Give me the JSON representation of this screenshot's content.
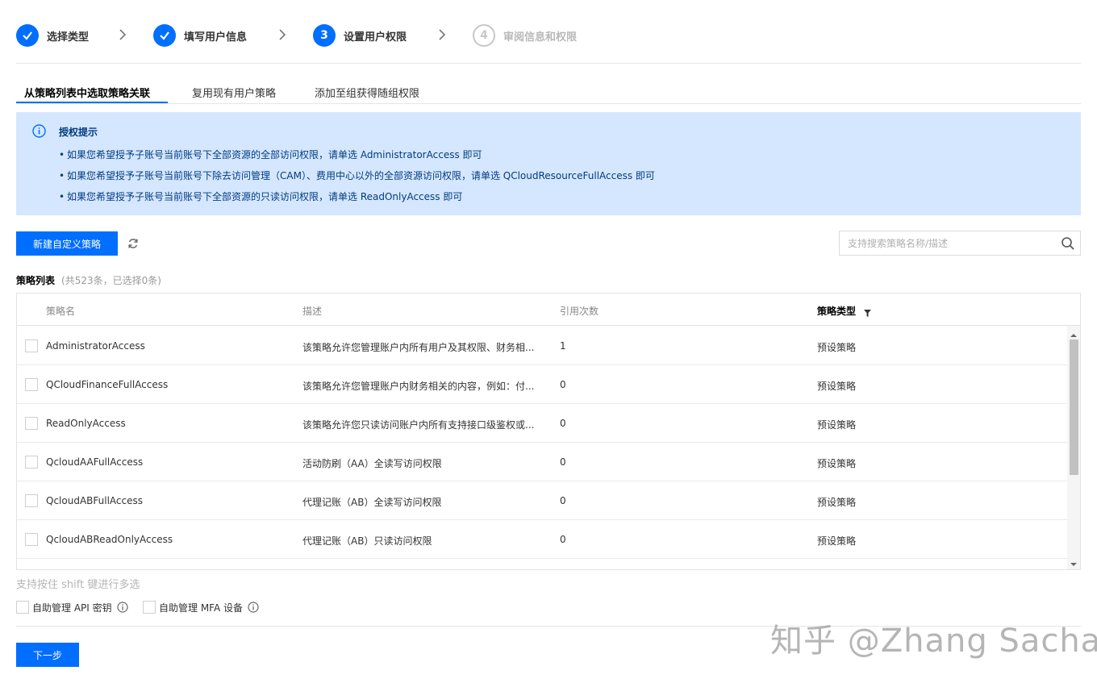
{
  "steps": [
    {
      "label": "选择类型",
      "state": "done"
    },
    {
      "label": "填写用户信息",
      "state": "done"
    },
    {
      "label": "设置用户权限",
      "state": "active",
      "number": "3"
    },
    {
      "label": "审阅信息和权限",
      "state": "pending",
      "number": "4"
    }
  ],
  "tabs": [
    {
      "label": "从策略列表中选取策略关联",
      "active": true
    },
    {
      "label": "复用现有用户策略",
      "active": false
    },
    {
      "label": "添加至组获得随组权限",
      "active": false
    }
  ],
  "notice": {
    "title": "授权提示",
    "items": [
      "如果您希望授予子账号当前账号下全部资源的全部访问权限，请单选 AdministratorAccess 即可",
      "如果您希望授予子账号当前账号下除去访问管理（CAM）、费用中心以外的全部资源访问权限，请单选 QCloudResourceFullAccess 即可",
      "如果您希望授予子账号当前账号下全部资源的只读访问权限，请单选 ReadOnlyAccess 即可"
    ]
  },
  "toolbar": {
    "new_policy_label": "新建自定义策略",
    "search_placeholder": "支持搜索策略名称/描述"
  },
  "list": {
    "title": "策略列表",
    "count": "(共523条，已选择0条)"
  },
  "table": {
    "headers": [
      "策略名",
      "描述",
      "引用次数",
      "策略类型"
    ],
    "rows": [
      {
        "name": "AdministratorAccess",
        "desc": "该策略允许您管理账户内所有用户及其权限、财务相...",
        "refs": "1",
        "type": "预设策略"
      },
      {
        "name": "QCloudFinanceFullAccess",
        "desc": "该策略允许您管理账户内财务相关的内容，例如：付...",
        "refs": "0",
        "type": "预设策略"
      },
      {
        "name": "ReadOnlyAccess",
        "desc": "该策略允许您只读访问账户内所有支持接口级鉴权或...",
        "refs": "0",
        "type": "预设策略"
      },
      {
        "name": "QcloudAAFullAccess",
        "desc": "活动防刷（AA）全读写访问权限",
        "refs": "0",
        "type": "预设策略"
      },
      {
        "name": "QcloudABFullAccess",
        "desc": "代理记账（AB）全读写访问权限",
        "refs": "0",
        "type": "预设策略"
      },
      {
        "name": "QcloudABReadOnlyAccess",
        "desc": "代理记账（AB）只读访问权限",
        "refs": "0",
        "type": "预设策略"
      }
    ]
  },
  "shift_tip": "支持按住 shift 键进行多选",
  "options": {
    "api_key_label": "自助管理 API 密钥",
    "mfa_label": "自助管理 MFA 设备"
  },
  "next_label": "下一步",
  "watermark": "知乎 @Zhang Sacha",
  "colors": {
    "primary": "#006eff",
    "notice_bg": "#d5e7ff",
    "notice_text": "#003b80"
  }
}
